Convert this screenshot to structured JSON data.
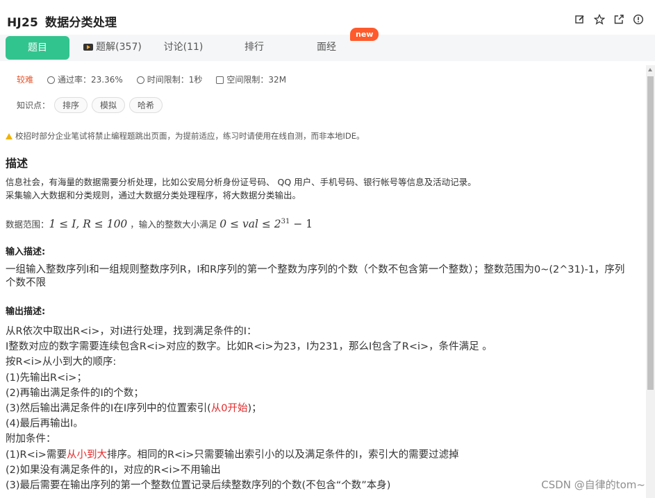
{
  "header": {
    "problem_id": "HJ25",
    "problem_title": "数据分类处理",
    "icons": [
      "edit-icon",
      "star-icon",
      "share-icon",
      "info-icon"
    ]
  },
  "tabs": [
    {
      "label": "题目",
      "active": true
    },
    {
      "label": "题解(357)",
      "icon": "video-icon"
    },
    {
      "label": "讨论(11)"
    },
    {
      "label": "排行"
    },
    {
      "label": "面经",
      "badge": "new"
    }
  ],
  "meta": {
    "difficulty": "较难",
    "pass_rate": "通过率：23.36%",
    "time_limit": "时间限制：1秒",
    "space_limit": "空间限制：32M"
  },
  "knowledge": {
    "label": "知识点：",
    "tags": [
      "排序",
      "模拟",
      "哈希"
    ]
  },
  "warning": "校招时部分企业笔试将禁止编程题跳出页面，为提前适应，练习时请使用在线自测，而非本地IDE。",
  "description": {
    "heading": "描述",
    "lines": [
      "信息社会，有海量的数据需要分析处理，比如公安局分析身份证号码、 QQ 用户、手机号码、银行帐号等信息及活动记录。",
      "采集输入大数据和分类规则，通过大数据分类处理程序，将大数据分类输出。"
    ],
    "range_prefix": "数据范围：",
    "range_math1": "1 ≤ I, R ≤ 100",
    "range_mid": "，输入的整数大小满足",
    "range_math2": "0 ≤ val ≤ 2",
    "range_exp": "31",
    "range_tail": " − 1"
  },
  "input": {
    "heading": "输入描述:",
    "text": "一组输入整数序列I和一组规则整数序列R，I和R序列的第一个整数为序列的个数（个数不包含第一个整数）；整数范围为0~(2^31)-1，序列个数不限"
  },
  "output": {
    "heading": "输出描述:",
    "l1": "从R依次中取出R<i>，对I进行处理，找到满足条件的I：",
    "l2": "I整数对应的数字需要连续包含R<i>对应的数字。比如R<i>为23，I为231，那么I包含了R<i>，条件满足 。",
    "l3": "按R<i>从小到大的顺序:",
    "l4": "(1)先输出R<i>；",
    "l5": "(2)再输出满足条件的I的个数；",
    "l6a": "(3)然后输出满足条件的I在I序列中的位置索引(",
    "l6red": "从0开始",
    "l6b": ")；",
    "l7": "(4)最后再输出I。",
    "l8": "附加条件：",
    "l9a": "(1)R<i>需要",
    "l9red": "从小到大",
    "l9b": "排序。相同的R<i>只需要输出索引小的以及满足条件的I，索引大的需要过滤掉",
    "l10": "(2)如果没有满足条件的I，对应的R<i>不用输出",
    "l11": "(3)最后需要在输出序列的第一个整数位置记录后续整数序列的个数(不包含“个数”本身)"
  },
  "watermark": "CSDN @自律的tom~",
  "colors": {
    "accent": "#32c48f",
    "badge": "#ff5a2c",
    "difficulty": "#e4572e",
    "highlight": "#e4292a"
  }
}
